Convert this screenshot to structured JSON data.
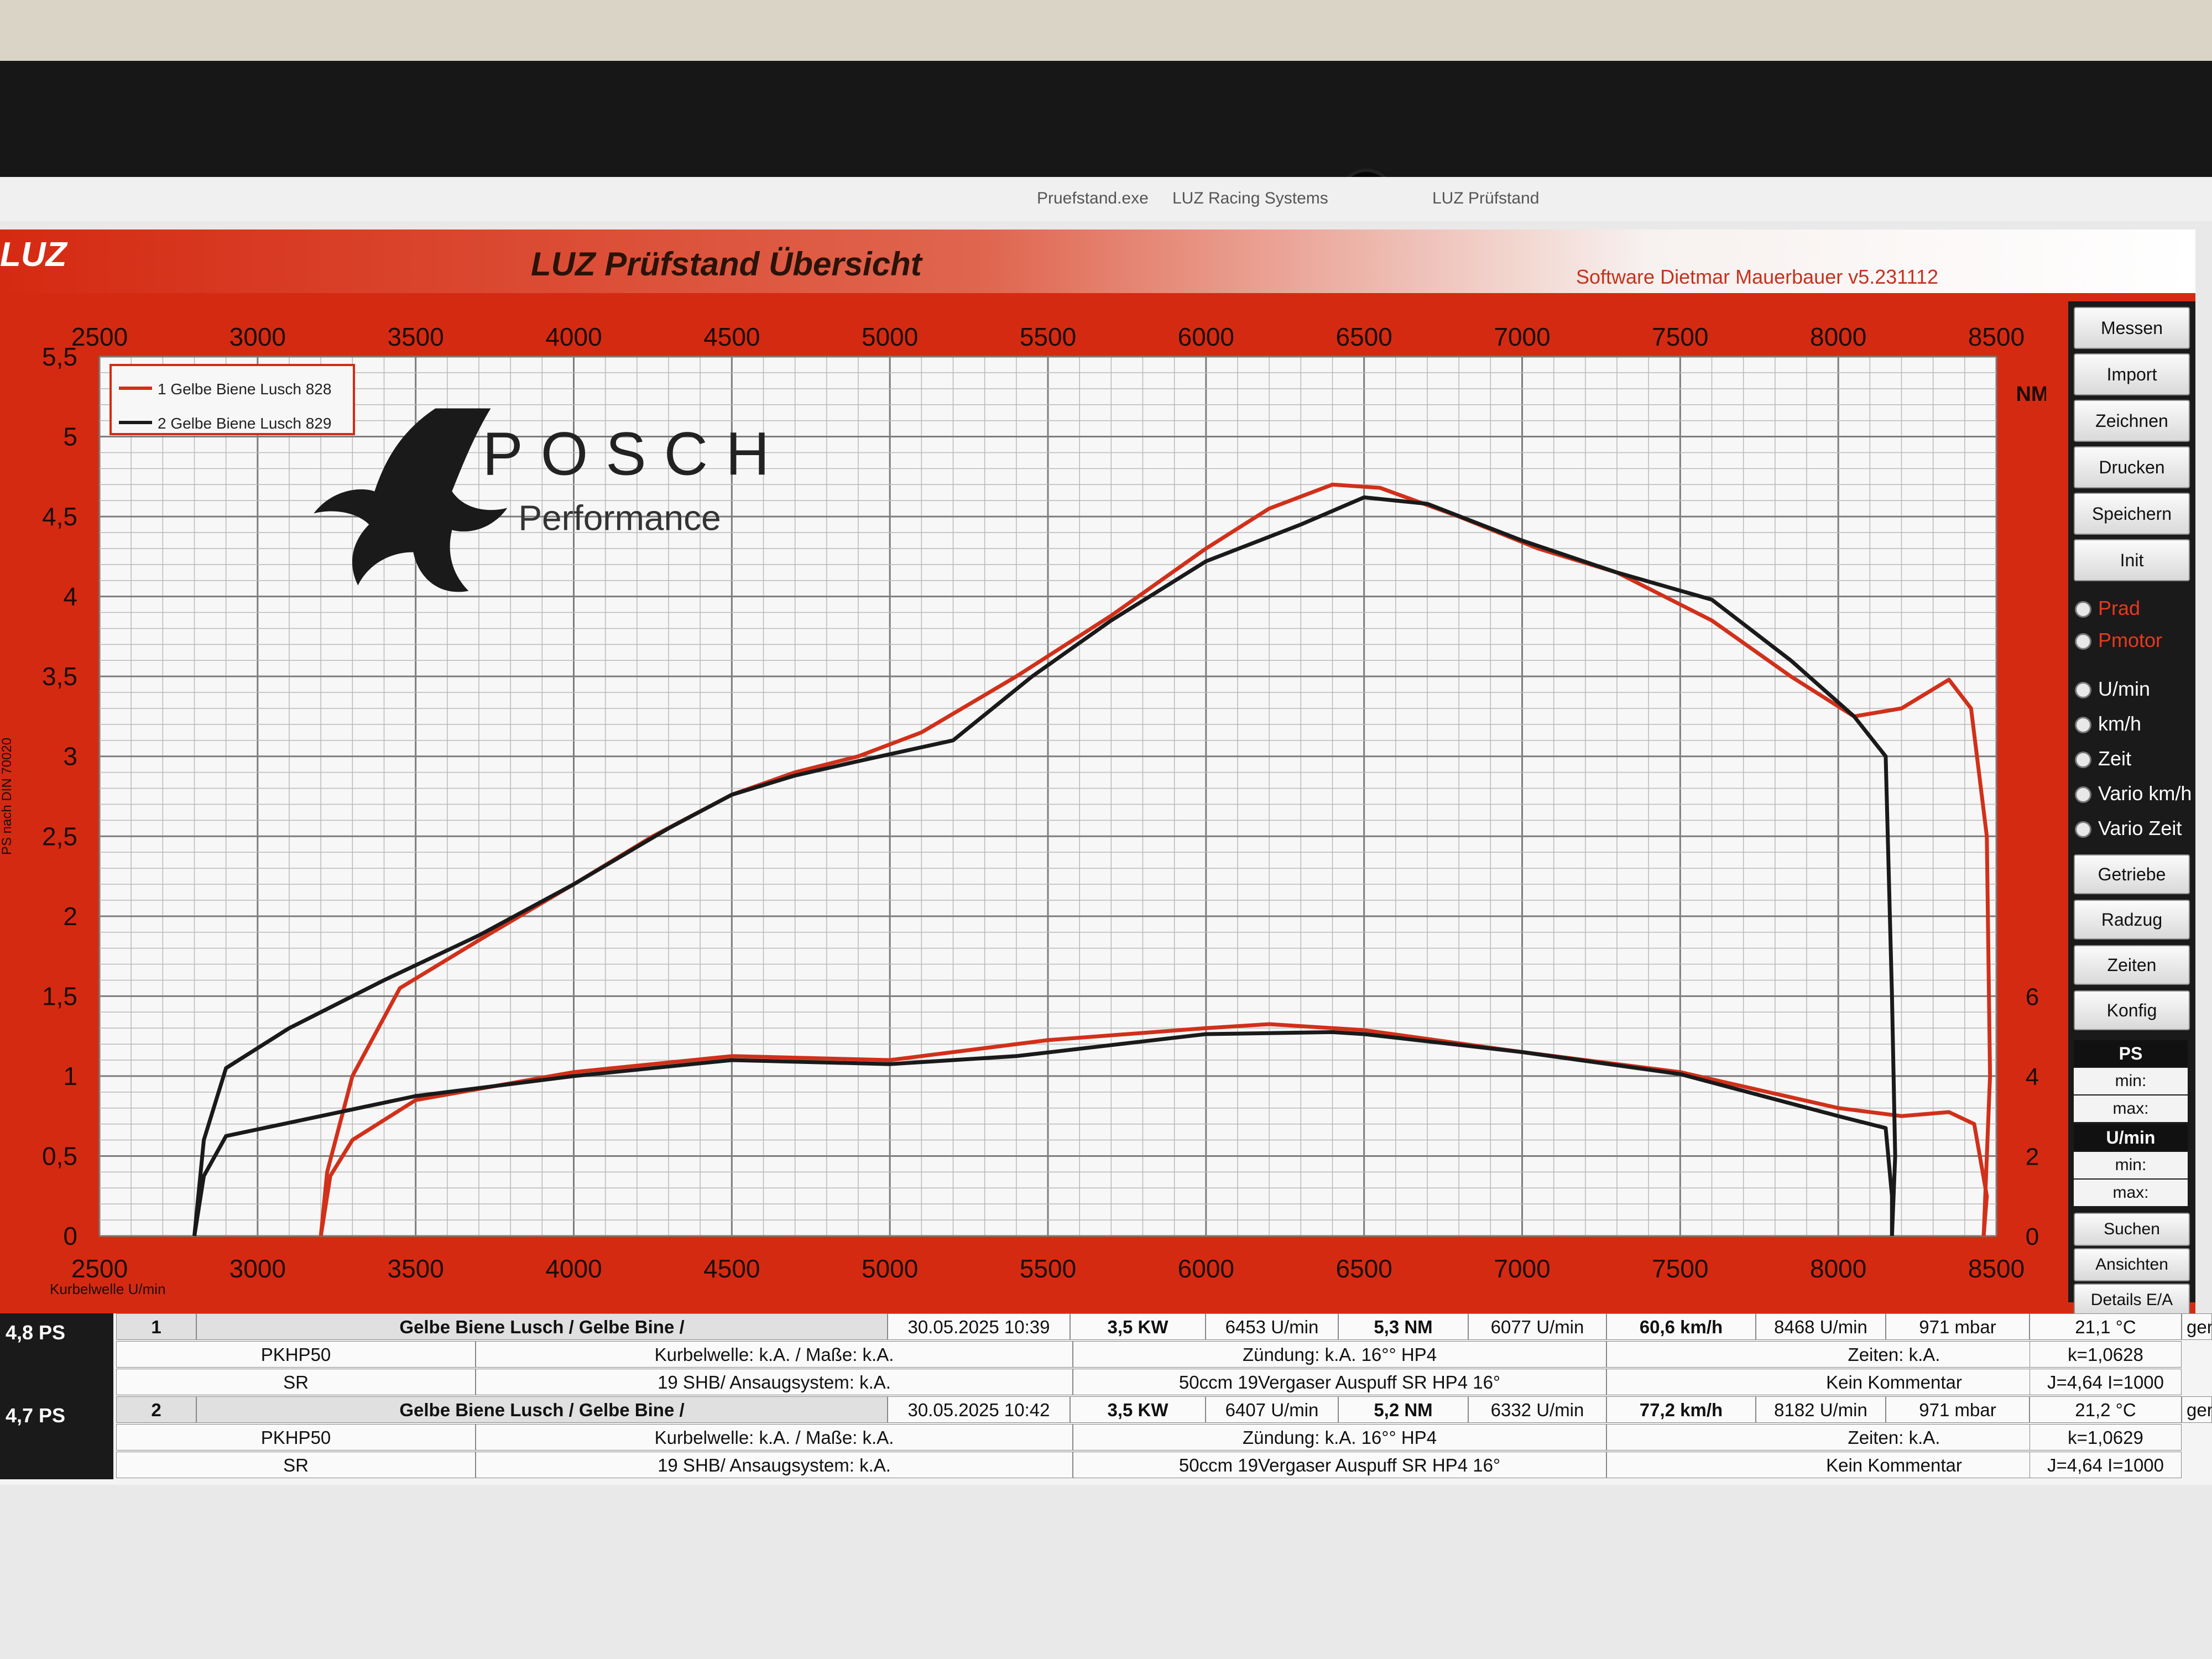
{
  "window": {
    "exe": "Pruefstand.exe",
    "company": "LUZ Racing Systems",
    "app_name": "LUZ Prüfstand"
  },
  "header": {
    "logo": "LUZ",
    "title": "LUZ Prüfstand  Übersicht",
    "software": "Software Dietmar Mauerbauer v5.231112"
  },
  "sidebar": {
    "buttons_top": [
      "Messen",
      "Import",
      "Zeichnen",
      "Drucken",
      "Speichern",
      "Init"
    ],
    "radios_power": [
      "Prad",
      "Pmotor"
    ],
    "radios_x": [
      "U/min",
      "km/h",
      "Zeit",
      "Vario km/h",
      "Vario Zeit"
    ],
    "buttons_mid": [
      "Getriebe",
      "Radzug",
      "Zeiten",
      "Konfig"
    ],
    "ps_head": "PS",
    "umin_head": "U/min",
    "min_label": "min:",
    "max_label": "max:",
    "buttons_bottom": [
      "Suchen",
      "Ansichten",
      "Details E/A"
    ]
  },
  "chart_data": {
    "type": "line",
    "x_ticks": [
      2500,
      3000,
      3500,
      4000,
      4500,
      5000,
      5500,
      6000,
      6500,
      7000,
      7500,
      8000,
      8500
    ],
    "xlim": [
      2500,
      8500
    ],
    "xlabel": "Kurbelwelle U/min",
    "y_left_ticks": [
      "0",
      "0,5",
      "1",
      "1,5",
      "2",
      "2,5",
      "3",
      "3,5",
      "4",
      "4,5",
      "5",
      "5,5"
    ],
    "ylim_left": [
      0,
      5.5
    ],
    "ylabel_left": "PS nach DIN 70020",
    "y_right_label": "NM",
    "y_right_ticks": [
      "0",
      "2",
      "4",
      "6"
    ],
    "ylim_right": [
      0,
      22
    ],
    "grid": true,
    "legend_position": "top-left",
    "watermark": {
      "line1": "POSCH",
      "line2": "Performance"
    },
    "series": [
      {
        "name": "1  Gelbe Biene Lusch 828",
        "color": "#d1301a",
        "power": [
          [
            3200,
            0
          ],
          [
            3220,
            0.4
          ],
          [
            3300,
            1.0
          ],
          [
            3450,
            1.55
          ],
          [
            3700,
            1.85
          ],
          [
            4000,
            2.2
          ],
          [
            4250,
            2.5
          ],
          [
            4500,
            2.76
          ],
          [
            4700,
            2.9
          ],
          [
            4900,
            3.0
          ],
          [
            5100,
            3.15
          ],
          [
            5400,
            3.5
          ],
          [
            5700,
            3.88
          ],
          [
            6000,
            4.3
          ],
          [
            6200,
            4.55
          ],
          [
            6400,
            4.7
          ],
          [
            6550,
            4.68
          ],
          [
            6800,
            4.5
          ],
          [
            7050,
            4.3
          ],
          [
            7300,
            4.15
          ],
          [
            7600,
            3.85
          ],
          [
            7850,
            3.5
          ],
          [
            8050,
            3.25
          ],
          [
            8200,
            3.3
          ],
          [
            8350,
            3.48
          ],
          [
            8420,
            3.3
          ],
          [
            8470,
            2.5
          ],
          [
            8480,
            1.0
          ],
          [
            8460,
            0
          ]
        ],
        "torque": [
          [
            3200,
            0
          ],
          [
            3230,
            1.5
          ],
          [
            3300,
            2.4
          ],
          [
            3500,
            3.4
          ],
          [
            4000,
            4.1
          ],
          [
            4500,
            4.5
          ],
          [
            5000,
            4.4
          ],
          [
            5500,
            4.9
          ],
          [
            6000,
            5.2
          ],
          [
            6200,
            5.3
          ],
          [
            6500,
            5.15
          ],
          [
            7000,
            4.6
          ],
          [
            7500,
            4.1
          ],
          [
            8000,
            3.2
          ],
          [
            8200,
            3.0
          ],
          [
            8350,
            3.1
          ],
          [
            8430,
            2.8
          ],
          [
            8470,
            1.0
          ],
          [
            8460,
            0
          ]
        ]
      },
      {
        "name": "2  Gelbe Biene Lusch 829",
        "color": "#1a1a1a",
        "power": [
          [
            2800,
            0
          ],
          [
            2830,
            0.6
          ],
          [
            2900,
            1.05
          ],
          [
            3100,
            1.3
          ],
          [
            3400,
            1.6
          ],
          [
            3700,
            1.88
          ],
          [
            4000,
            2.2
          ],
          [
            4300,
            2.55
          ],
          [
            4500,
            2.76
          ],
          [
            4700,
            2.88
          ],
          [
            4900,
            2.97
          ],
          [
            5200,
            3.1
          ],
          [
            5450,
            3.5
          ],
          [
            5700,
            3.85
          ],
          [
            6000,
            4.22
          ],
          [
            6300,
            4.45
          ],
          [
            6500,
            4.62
          ],
          [
            6700,
            4.58
          ],
          [
            7000,
            4.35
          ],
          [
            7300,
            4.15
          ],
          [
            7600,
            3.98
          ],
          [
            7850,
            3.6
          ],
          [
            8050,
            3.25
          ],
          [
            8150,
            3.0
          ],
          [
            8170,
            1.5
          ],
          [
            8180,
            0.5
          ],
          [
            8170,
            0
          ]
        ],
        "torque": [
          [
            2800,
            0
          ],
          [
            2830,
            1.5
          ],
          [
            2900,
            2.5
          ],
          [
            3200,
            3.0
          ],
          [
            3500,
            3.5
          ],
          [
            4000,
            4.0
          ],
          [
            4500,
            4.4
          ],
          [
            5000,
            4.3
          ],
          [
            5400,
            4.5
          ],
          [
            6000,
            5.05
          ],
          [
            6400,
            5.1
          ],
          [
            6500,
            5.05
          ],
          [
            7000,
            4.6
          ],
          [
            7500,
            4.05
          ],
          [
            8000,
            3.0
          ],
          [
            8150,
            2.7
          ],
          [
            8170,
            1.0
          ],
          [
            8170,
            0
          ]
        ]
      }
    ]
  },
  "runs": [
    {
      "ps": "4,8  PS",
      "nr": "1",
      "name": "Gelbe Biene Lusch / Gelbe Bine /",
      "date": "30.05.2025 10:39",
      "kw": "3,5  KW",
      "kw_rpm": "6453  U/min",
      "nm": "5,3  NM",
      "nm_rpm": "6077  U/min",
      "speed": "60,6 km/h",
      "speed_rpm": "8468  U/min",
      "pressure": "971  mbar",
      "temp": "21,1 °C",
      "extra": "ger",
      "model": "PKHP50",
      "kurbel": "Kurbelwelle: k.A. / Maße: k.A.",
      "zuendung": "Zündung: k.A. 16°° HP4",
      "zeiten": "Zeiten: k.A.",
      "k": "k=1,0628",
      "variant": "SR",
      "ansaug": "19 SHB/ Ansaugsystem: k.A.",
      "auspuff": "50ccm 19Vergaser Auspuff SR HP4 16°",
      "kommentar": "Kein Kommentar",
      "j": "J=4,64 I=1000"
    },
    {
      "ps": "4,7  PS",
      "nr": "2",
      "name": "Gelbe Biene Lusch / Gelbe Bine /",
      "date": "30.05.2025 10:42",
      "kw": "3,5  KW",
      "kw_rpm": "6407  U/min",
      "nm": "5,2  NM",
      "nm_rpm": "6332  U/min",
      "speed": "77,2 km/h",
      "speed_rpm": "8182  U/min",
      "pressure": "971  mbar",
      "temp": "21,2 °C",
      "extra": "ger",
      "model": "PKHP50",
      "kurbel": "Kurbelwelle: k.A. / Maße: k.A.",
      "zuendung": "Zündung: k.A. 16°° HP4",
      "zeiten": "Zeiten: k.A.",
      "k": "k=1,0629",
      "variant": "SR",
      "ansaug": "19 SHB/ Ansaugsystem: k.A.",
      "auspuff": "50ccm 19Vergaser Auspuff SR HP4 16°",
      "kommentar": "Kein Kommentar",
      "j": "J=4,64 I=1000"
    }
  ]
}
